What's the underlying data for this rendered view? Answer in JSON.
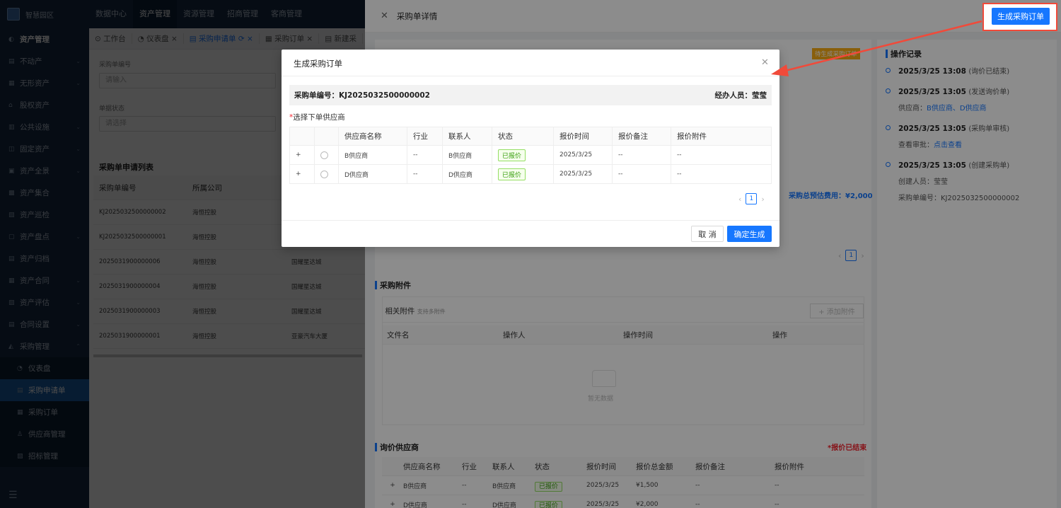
{
  "app": {
    "logo_text": "智慧园区"
  },
  "topnav": [
    "数据中心",
    "资产管理",
    "资源管理",
    "招商管理",
    "客商管理"
  ],
  "sidebar": {
    "head": "资产管理",
    "items": [
      "不动产",
      "无形资产",
      "股权资产",
      "公共设施",
      "固定资产",
      "资产全景",
      "资产集合",
      "资产巡检",
      "资产盘点",
      "资产归档",
      "资产合同",
      "资产评估",
      "合同设置",
      "采购管理"
    ],
    "sub": [
      "仪表盘",
      "采购申请单",
      "采购订单",
      "供应商管理",
      "招标管理"
    ]
  },
  "tabs": [
    "工作台",
    "仪表盘",
    "采购申请单",
    "采购订单",
    "新建采"
  ],
  "listpage": {
    "f1_label": "采购单编号",
    "f1_ph": "请输入",
    "f2_label": "单据状态",
    "f2_ph": "请选择",
    "title": "采购单申请列表",
    "headers": [
      "采购单编号",
      "所属公司"
    ],
    "rows": [
      [
        "KJ2025032500000002",
        "海恒控股",
        ""
      ],
      [
        "KJ2025032500000001",
        "海恒控股",
        ""
      ],
      [
        "2025031900000006",
        "海恒控股",
        "国耀星达城"
      ],
      [
        "2025031900000004",
        "海恒控股",
        "国耀星达城"
      ],
      [
        "2025031900000003",
        "海恒控股",
        "国耀星达城"
      ],
      [
        "2025031900000001",
        "海恒控股",
        "亚豪汽车大厦"
      ]
    ]
  },
  "drawer": {
    "title": "采购单详情",
    "gen_button": "生成采购订单",
    "status_tag": "待生成采购订单",
    "total_cost": "采购总预估费用：¥2,000",
    "attach_section": "采购附件",
    "attach_label": "相关附件",
    "attach_hint": "支持多附件",
    "add_attach": "+ 添加附件",
    "attach_headers": [
      "文件名",
      "操作人",
      "操作时间",
      "操作"
    ],
    "empty_text": "暂无数据",
    "inquiry_section": "询价供应商",
    "inquiry_status": "*报价已结束",
    "inquiry_headers": [
      "供应商名称",
      "行业",
      "联系人",
      "状态",
      "报价时间",
      "报价总金额",
      "报价备注",
      "报价附件"
    ],
    "inquiry_rows": [
      [
        "+",
        "B供应商",
        "--",
        "B供应商",
        "已报价",
        "2025/3/25",
        "¥1,500",
        "--",
        "--"
      ],
      [
        "+",
        "D供应商",
        "--",
        "D供应商",
        "已报价",
        "2025/3/25",
        "¥2,000",
        "--",
        "--"
      ]
    ],
    "page": "1"
  },
  "timeline": {
    "title": "操作记录",
    "entries": [
      {
        "time": "2025/3/25 13:08",
        "action": "(询价已结束)"
      },
      {
        "time": "2025/3/25 13:05",
        "action": "(发送询价单)",
        "sub_label": "供应商：",
        "sub_link": "B供应商、D供应商"
      },
      {
        "time": "2025/3/25 13:05",
        "action": "(采购单审核)",
        "sub_label": "查看审批：",
        "sub_link": "点击查看"
      },
      {
        "time": "2025/3/25 13:05",
        "action": "(创建采购单)",
        "sub_label": "创建人员：莹莹",
        "sub2": "采购单编号：KJ2025032500000002"
      }
    ]
  },
  "modal": {
    "title": "生成采购订单",
    "order_no": "采购单编号：KJ2025032500000002",
    "handler": "经办人员：莹莹",
    "required_mark": "*",
    "select_label": "选择下单供应商",
    "headers": [
      "供应商名称",
      "行业",
      "联系人",
      "状态",
      "报价时间",
      "报价备注",
      "报价附件"
    ],
    "rows": [
      [
        "+",
        "B供应商",
        "--",
        "B供应商",
        "已报价",
        "2025/3/25",
        "--",
        "--"
      ],
      [
        "+",
        "D供应商",
        "--",
        "D供应商",
        "已报价",
        "2025/3/25",
        "--",
        "--"
      ]
    ],
    "page": "1",
    "cancel": "取 消",
    "confirm": "确定生成"
  },
  "colors": {
    "primary": "#1677ff",
    "sidebar_bg": "#142a45",
    "annotation_red": "#f04a3a"
  }
}
